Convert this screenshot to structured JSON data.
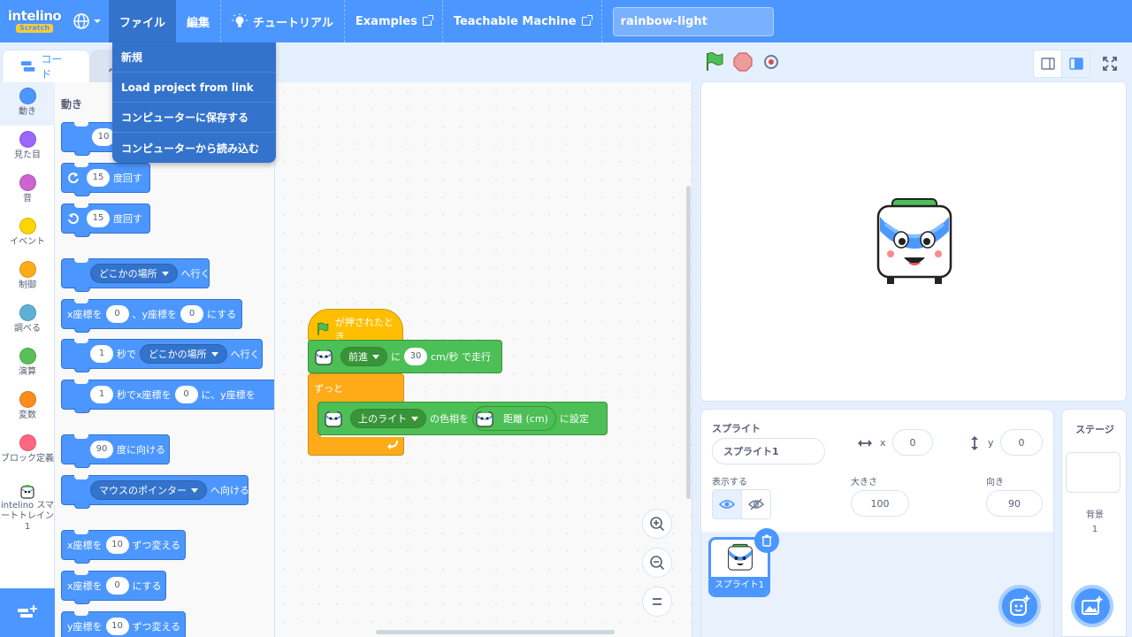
{
  "app": {
    "logo_text": "intelino",
    "logo_sub": "Scratch"
  },
  "menu": {
    "file": "ファイル",
    "edit": "編集",
    "tutorial": "チュートリアル",
    "examples": "Examples",
    "teachable": "Teachable Machine",
    "project_title": "rainbow-light"
  },
  "file_menu": {
    "items": [
      "新規",
      "Load project from link",
      "コンピューターに保存する",
      "コンピューターから読み込む"
    ]
  },
  "tabs": {
    "code": "コード"
  },
  "categories": [
    {
      "label": "動き",
      "color": "#4c97ff"
    },
    {
      "label": "見た目",
      "color": "#9966ff"
    },
    {
      "label": "音",
      "color": "#cf63cf"
    },
    {
      "label": "イベント",
      "color": "#ffd500"
    },
    {
      "label": "制御",
      "color": "#ffab19"
    },
    {
      "label": "調べる",
      "color": "#5cb1d6"
    },
    {
      "label": "演算",
      "color": "#59c059"
    },
    {
      "label": "変数",
      "color": "#ff8c1a"
    },
    {
      "label": "ブロック定義",
      "color": "#ff6680"
    },
    {
      "label": "intelino スマートトレイン 1",
      "color": "#4c97ff"
    }
  ],
  "palette": {
    "title": "動き",
    "b1_num": "10",
    "b2_num": "15",
    "b2_text": "度回す",
    "b3_num": "15",
    "b3_text": "度回す",
    "b4_drop": "どこかの場所",
    "b4_text": "へ行く",
    "b5_a": "x座標を",
    "b5_n1": "0",
    "b5_b": "、y座標を",
    "b5_n2": "0",
    "b5_c": "にする",
    "b6_n": "1",
    "b6_a": "秒で",
    "b6_drop": "どこかの場所",
    "b6_b": "へ行く",
    "b7_n": "1",
    "b7_a": "秒でx座標を",
    "b7_n2": "0",
    "b7_b": "に、y座標を",
    "b8_n": "90",
    "b8_text": "度に向ける",
    "b9_drop": "マウスのポインター",
    "b9_text": "へ向ける",
    "b10_a": "x座標を",
    "b10_n": "10",
    "b10_b": "ずつ変える",
    "b11_a": "x座標を",
    "b11_n": "0",
    "b11_b": "にする",
    "b12_a": "y座標を",
    "b12_n": "10",
    "b12_b": "ずつ変える"
  },
  "script": {
    "hat_text": "が押されたとき",
    "move_drop": "前進",
    "move_a": "に",
    "move_num": "30",
    "move_b": "cm/秒 で走行",
    "forever": "ずっと",
    "light_drop": "上のライト",
    "light_a": "の色相を",
    "dist_text": "距離 (cm)",
    "light_b": "に設定"
  },
  "sprite_info": {
    "sprite_label": "スプライト",
    "sprite_name": "スプライト1",
    "x_label": "x",
    "x_value": "0",
    "y_label": "y",
    "y_value": "0",
    "show_label": "表示する",
    "size_label": "大きさ",
    "size_value": "100",
    "direction_label": "向き",
    "direction_value": "90",
    "thumb_caption": "スプライト1"
  },
  "stage_pane": {
    "title": "ステージ",
    "backdrop_label": "背景",
    "backdrop_count": "1"
  },
  "colors": {
    "menu_bar": "#4c97ff",
    "motion": "#4c97ff",
    "events": "#ffbf00",
    "control": "#ffab19",
    "extension": "#4cbf56"
  }
}
